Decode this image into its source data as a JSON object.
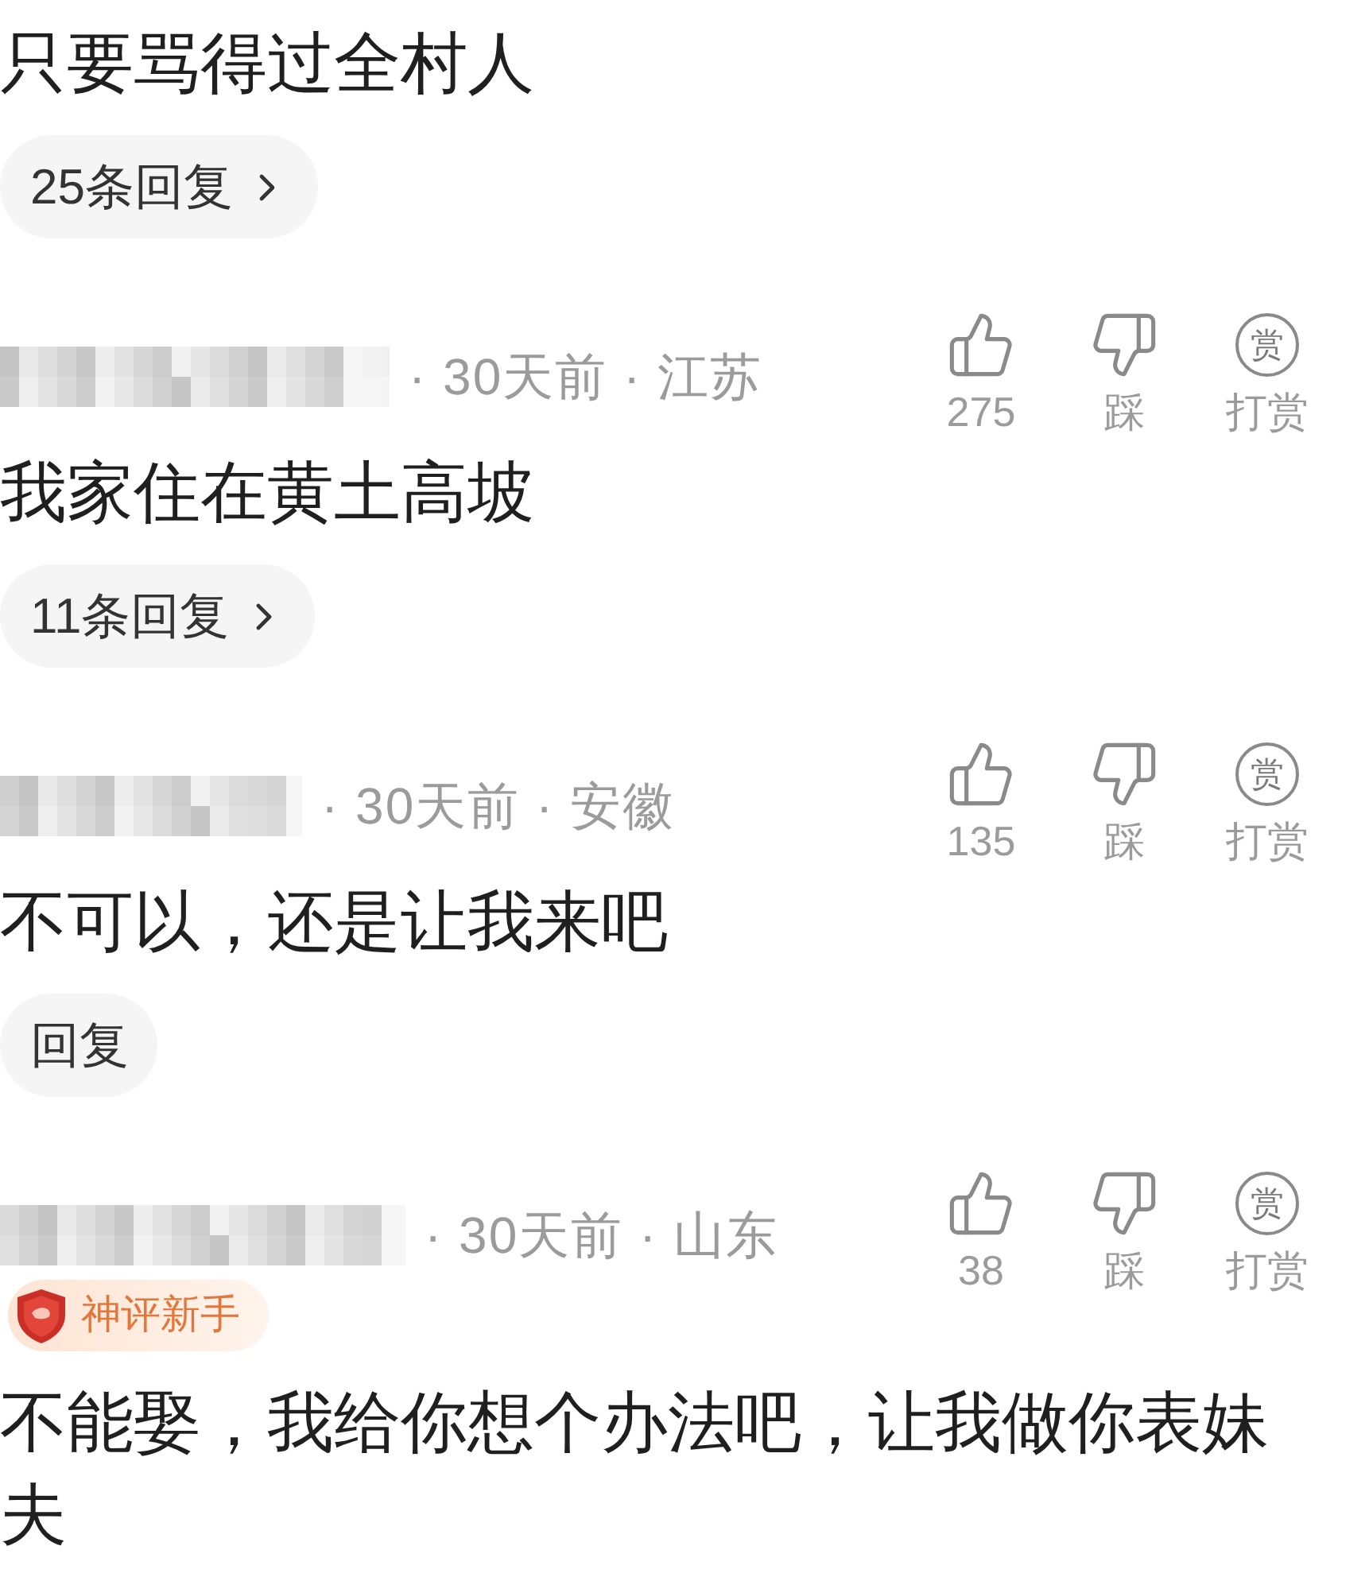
{
  "comments": [
    {
      "text": "只要骂得过全村人",
      "replies_button": {
        "label": "25条回复",
        "chevron": true
      }
    },
    {
      "author_hidden": true,
      "meta": "· 30天前 · 江苏",
      "actions": [
        {
          "kind": "like",
          "label": "275"
        },
        {
          "kind": "dislike",
          "label": "踩"
        },
        {
          "kind": "reward",
          "label": "打赏",
          "icon_text": "赏"
        }
      ],
      "text": "我家住在黄土高坡",
      "replies_button": {
        "label": "11条回复",
        "chevron": true
      }
    },
    {
      "author_hidden": true,
      "meta": "· 30天前 · 安徽",
      "actions": [
        {
          "kind": "like",
          "label": "135"
        },
        {
          "kind": "dislike",
          "label": "踩"
        },
        {
          "kind": "reward",
          "label": "打赏",
          "icon_text": "赏"
        }
      ],
      "text": "不可以，还是让我来吧",
      "replies_button": {
        "label": "回复",
        "chevron": false
      }
    },
    {
      "author_hidden": true,
      "meta": "· 30天前 · 山东",
      "badge": {
        "label": "神评新手"
      },
      "actions": [
        {
          "kind": "like",
          "label": "38"
        },
        {
          "kind": "dislike",
          "label": "踩"
        },
        {
          "kind": "reward",
          "label": "打赏",
          "icon_text": "赏"
        }
      ],
      "text": "不能娶，我给你想个办法吧，让我做你表妹夫"
    }
  ]
}
